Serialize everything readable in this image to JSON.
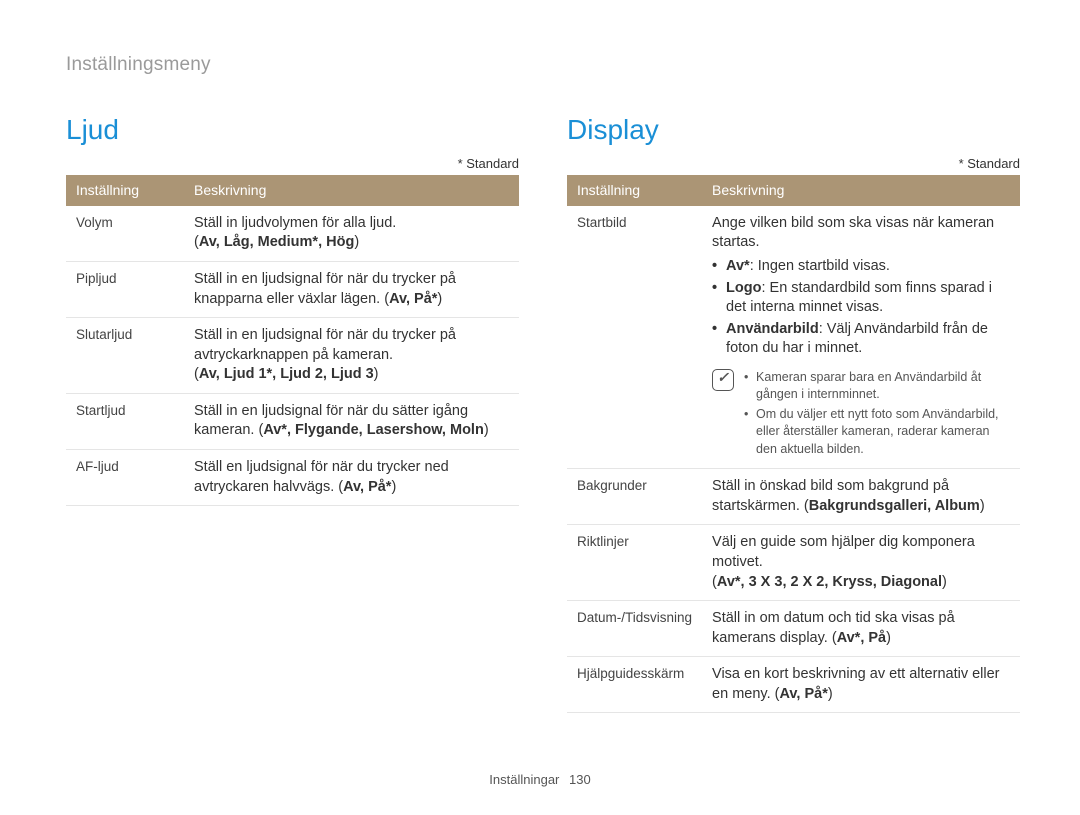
{
  "breadcrumb": "Inställningsmeny",
  "standard_note": "* Standard",
  "footer_label": "Inställningar",
  "footer_page": "130",
  "sound": {
    "title": "Ljud",
    "headers": {
      "setting": "Inställning",
      "desc": "Beskrivning"
    },
    "rows": {
      "volym": {
        "setting": "Volym",
        "desc": "Ställ in ljudvolymen för alla ljud.",
        "opts": "Av, Låg, Medium*, Hög"
      },
      "pipljud": {
        "setting": "Pipljud",
        "desc_a": "Ställ in en ljudsignal för när du trycker på knapparna eller växlar lägen. (",
        "opts": "Av, På*",
        "desc_b": ")"
      },
      "slutarljud": {
        "setting": "Slutarljud",
        "desc": "Ställ in en ljudsignal för när du trycker på avtryckarknappen på kameran.",
        "opts": "Av, Ljud 1*, Ljud 2, Ljud 3"
      },
      "startljud": {
        "setting": "Startljud",
        "desc_a": "Ställ in en ljudsignal för när du sätter igång kameran. (",
        "opts": "Av*, Flygande, Lasershow, Moln",
        "desc_b": ")"
      },
      "afljud": {
        "setting": "AF-ljud",
        "desc_a": "Ställ en ljudsignal för när du trycker ned avtryckaren halvvägs. (",
        "opts": "Av, På*",
        "desc_b": ")"
      }
    }
  },
  "display": {
    "title": "Display",
    "headers": {
      "setting": "Inställning",
      "desc": "Beskrivning"
    },
    "rows": {
      "startbild": {
        "setting": "Startbild",
        "intro": "Ange vilken bild som ska visas när kameran startas.",
        "b1_key": "Av*",
        "b1_txt": ": Ingen startbild visas.",
        "b2_key": "Logo",
        "b2_txt": ": En standardbild som finns sparad i det interna minnet visas.",
        "b3_key": "Användarbild",
        "b3_txt": ": Välj Användarbild från de foton du har i minnet.",
        "note1": "Kameran sparar bara en Användarbild åt gången i internminnet.",
        "note2": "Om du väljer ett nytt foto som Användarbild, eller återställer kameran, raderar kameran den aktuella bilden."
      },
      "bakgrunder": {
        "setting": "Bakgrunder",
        "desc_a": "Ställ in önskad bild som bakgrund på startskärmen. (",
        "opts": "Bakgrundsgalleri, Album",
        "desc_b": ")"
      },
      "riktlinjer": {
        "setting": "Riktlinjer",
        "desc": "Välj en guide som hjälper dig komponera motivet.",
        "opts": "Av*, 3 X 3, 2 X 2, Kryss, Diagonal"
      },
      "datumtid": {
        "setting": "Datum-/Tidsvisning",
        "desc_a": "Ställ in om datum och tid ska visas på kamerans display. (",
        "opts": "Av*, På",
        "desc_b": ")"
      },
      "hjalp": {
        "setting": "Hjälpguidesskärm",
        "desc_a": "Visa en kort beskrivning av ett alternativ eller en meny. (",
        "opts": "Av, På*",
        "desc_b": ")"
      }
    }
  }
}
